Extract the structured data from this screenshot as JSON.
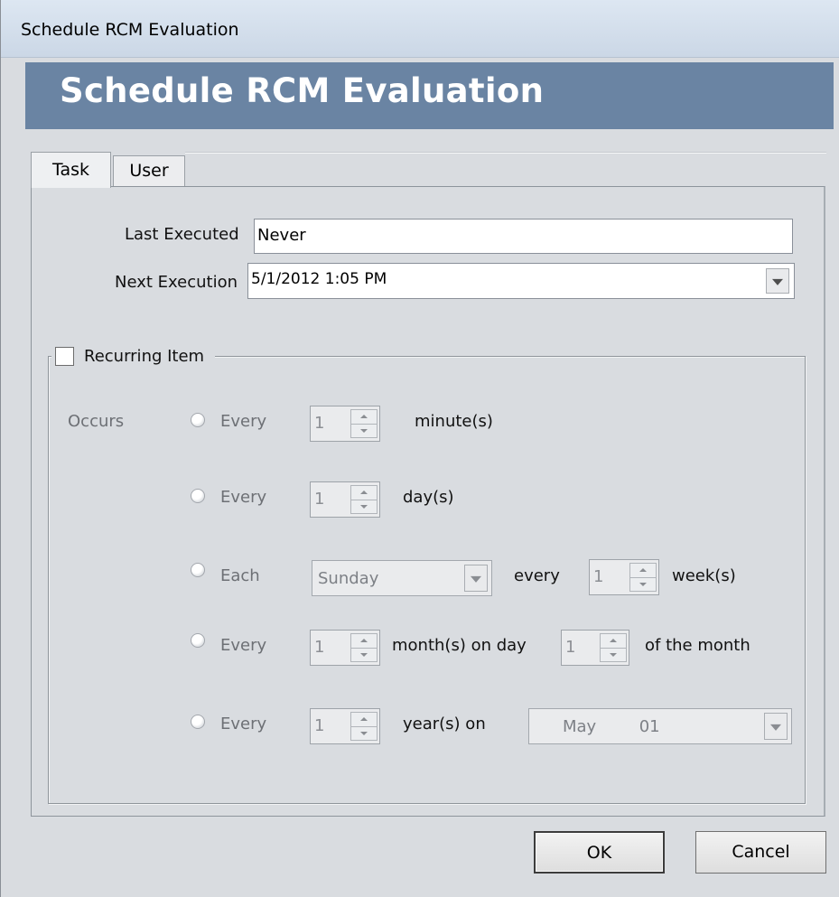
{
  "window": {
    "title": "Schedule RCM Evaluation"
  },
  "banner": {
    "title": "Schedule RCM Evaluation"
  },
  "tabs": [
    {
      "label": "Task",
      "active": true
    },
    {
      "label": "User",
      "active": false
    }
  ],
  "task": {
    "last_executed_label": "Last Executed",
    "last_executed_value": "Never",
    "next_execution_label": "Next Execution",
    "next_execution_value": "5/1/2012 1:05 PM"
  },
  "recurring": {
    "checkbox_label": "Recurring Item",
    "checked": false,
    "occurs_label": "Occurs",
    "rows": [
      {
        "radio_label": "Every",
        "spin_value": "1",
        "unit": "minute(s)"
      },
      {
        "radio_label": "Every",
        "spin_value": "1",
        "unit": "day(s)"
      },
      {
        "radio_label": "Each",
        "day_value": "Sunday",
        "every_label": "every",
        "spin_value": "1",
        "unit": "week(s)"
      },
      {
        "radio_label": "Every",
        "spin_value": "1",
        "unit": "month(s) on day",
        "day_spin_value": "1",
        "suffix": "of the month"
      },
      {
        "radio_label": "Every",
        "spin_value": "1",
        "unit": "year(s) on",
        "date_month": "May",
        "date_day": "01"
      }
    ]
  },
  "buttons": {
    "ok": "OK",
    "cancel": "Cancel"
  },
  "icons": {
    "dropdown": "chevron-down-icon",
    "spin_up": "spin-up-icon",
    "spin_down": "spin-down-icon"
  },
  "colors": {
    "banner": "#6a84a3",
    "window_bg": "#d9dce0",
    "titlebar": "#cbd7e6"
  }
}
